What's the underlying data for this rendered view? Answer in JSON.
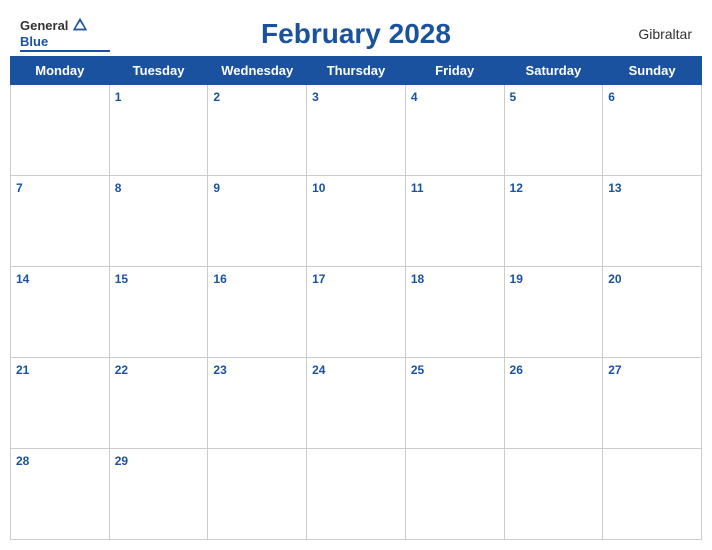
{
  "header": {
    "title": "February 2028",
    "region": "Gibraltar",
    "logo_general": "General",
    "logo_blue": "Blue"
  },
  "weekdays": [
    "Monday",
    "Tuesday",
    "Wednesday",
    "Thursday",
    "Friday",
    "Saturday",
    "Sunday"
  ],
  "weeks": [
    [
      null,
      1,
      2,
      3,
      4,
      5,
      6
    ],
    [
      7,
      8,
      9,
      10,
      11,
      12,
      13
    ],
    [
      14,
      15,
      16,
      17,
      18,
      19,
      20
    ],
    [
      21,
      22,
      23,
      24,
      25,
      26,
      27
    ],
    [
      28,
      29,
      null,
      null,
      null,
      null,
      null
    ]
  ]
}
